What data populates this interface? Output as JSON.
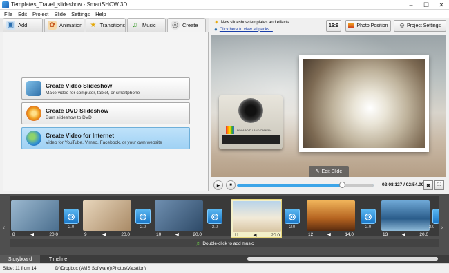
{
  "window": {
    "title": "Templates_Travel_slideshow - SmartSHOW 3D",
    "controls": [
      "–",
      "☐",
      "✕"
    ]
  },
  "menu": [
    "File",
    "Edit",
    "Project",
    "Slide",
    "Settings",
    "Help"
  ],
  "tabs": [
    {
      "label": "Add",
      "icon": "add-folder-icon"
    },
    {
      "label": "Animation",
      "icon": "palette-icon"
    },
    {
      "label": "Transitions",
      "icon": "star-icon"
    },
    {
      "label": "Music",
      "icon": "music-note-icon"
    },
    {
      "label": "Create",
      "icon": "film-reel-icon",
      "active": true
    }
  ],
  "create_options": [
    {
      "title": "Create Video Slideshow",
      "subtitle": "Make video for computer, tablet, or smartphone",
      "icon": "monitor-devices-icon",
      "selected": false
    },
    {
      "title": "Create DVD Slideshow",
      "subtitle": "Burn slideshow to DVD",
      "icon": "dvd-disc-icon",
      "selected": false
    },
    {
      "title": "Create Video for Internet",
      "subtitle": "Video for YouTube, Vimeo, Facebook, or your own website",
      "icon": "globe-icon",
      "selected": true
    }
  ],
  "promo": {
    "line1": "New slideshow templates and effects",
    "line2": "Click here to view all packs..."
  },
  "toolbar": {
    "aspect_label": "16:9",
    "photo_position_label": "Photo Position",
    "project_settings_label": "Project Settings"
  },
  "preview": {
    "edit_slide_label": "Edit Slide",
    "camera_text": "POLAROID LAND CAMERA"
  },
  "player": {
    "time_current": "02:08.127",
    "time_total": "02:54.000",
    "progress": 0.76
  },
  "slides": [
    {
      "number": "8",
      "duration": "20.0",
      "thumb": "#7fa0b8",
      "selected": false
    },
    {
      "number": "9",
      "duration": "20.0",
      "thumb": "#c9b8a0",
      "selected": false
    },
    {
      "number": "10",
      "duration": "20.0",
      "thumb": "#5e7fa1",
      "selected": false
    },
    {
      "number": "11",
      "duration": "20.0",
      "thumb": "#dcd3c0",
      "selected": true
    },
    {
      "number": "12",
      "duration": "14.0",
      "thumb": "#b0712d",
      "selected": false
    },
    {
      "number": "13",
      "duration": "20.0",
      "thumb": "#3c6f98",
      "selected": false
    }
  ],
  "transitions": [
    {
      "duration": "2.0"
    },
    {
      "duration": "2.0"
    },
    {
      "duration": "2.0"
    },
    {
      "duration": "2.0"
    },
    {
      "duration": "2.0"
    },
    {
      "duration": "2.0"
    }
  ],
  "music_hint": "Double-click to add music",
  "bottom_tabs": [
    "Storyboard",
    "Timeline"
  ],
  "status": {
    "slide_info": "Slide: 11 from 14",
    "path": "D:\\Dropbox (AMS Software)\\Photos\\Vacation\\"
  },
  "colors": {
    "accent_blue": "#3da5e8",
    "selected_button": "#b1daf7",
    "storyboard_bg": "#4f4f4f"
  }
}
